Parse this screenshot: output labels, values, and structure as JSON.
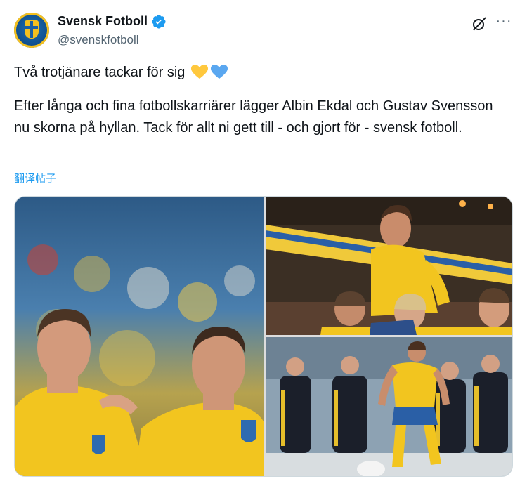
{
  "author": {
    "display_name": "Svensk Fotboll",
    "handle": "@svenskfotboll",
    "verified": true,
    "avatar_icon": "swedish-fa-crest-icon"
  },
  "actions": {
    "grok_icon": "grok-icon",
    "more_icon": "more-options-icon",
    "more_label": "···"
  },
  "tweet": {
    "line1": "Två trotjänare tackar för sig",
    "emoji_1": "yellow-heart",
    "emoji_2": "blue-heart",
    "line2": "Efter långa och fina fotbollskarriärer lägger Albin Ekdal och Gustav Svensson nu skorna på hyllan. Tack för allt ni gett till - och gjort för - svensk fotboll.",
    "translate_label": "翻译帖子"
  },
  "media": {
    "photo_count": 3,
    "colors": {
      "sweden_yellow": "#f4c01e",
      "sweden_blue": "#1a5fa3",
      "link_blue": "#1d9bf0"
    }
  }
}
